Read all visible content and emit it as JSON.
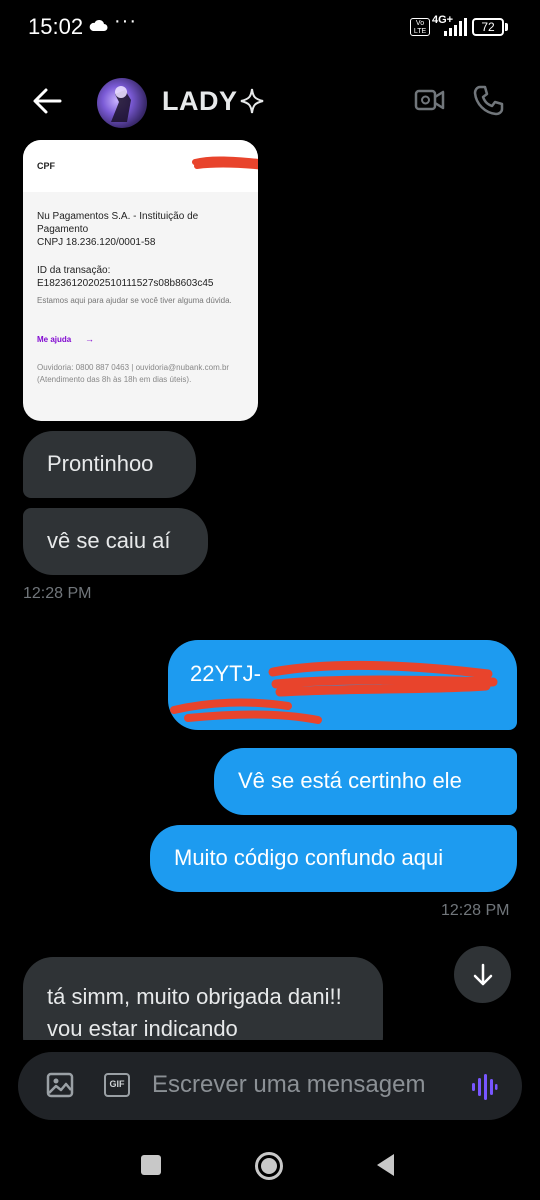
{
  "status_bar": {
    "time": "15:02",
    "dots": "···",
    "volte": "Vo LTE",
    "network": "4G+",
    "battery": "72"
  },
  "header": {
    "contact_name": "LADY"
  },
  "receipt": {
    "cpf_label": "CPF",
    "cpf_masked": "•••••••••••",
    "institution": "Nu Pagamentos S.A. - Instituição de Pagamento",
    "cnpj": "CNPJ 18.236.120/0001-58",
    "transaction_label": "ID da transação:",
    "transaction_id": "E18236120202510111527s08b8603c45",
    "help_text": "Estamos aqui para ajudar se você tiver alguma dúvida.",
    "help_link": "Me ajuda",
    "ombudsman": "Ouvidoria: 0800 887 0463 | ouvidoria@nubank.com.br (Atendimento das 8h às 18h em dias úteis)."
  },
  "messages": [
    {
      "direction": "in",
      "text": "Prontinhoo"
    },
    {
      "direction": "in",
      "text": "vê se caiu aí"
    },
    {
      "direction": "out",
      "text": "22YTJ-"
    },
    {
      "direction": "out",
      "text": "Vê se está certinho ele"
    },
    {
      "direction": "out",
      "text": "Muito código confundo aqui"
    },
    {
      "direction": "in",
      "text": "tá simm, muito obrigada dani!! vou estar indicando"
    }
  ],
  "timestamps": {
    "incoming": "12:28 PM",
    "outgoing": "12:28 PM"
  },
  "composer": {
    "gif_label": "GIF",
    "placeholder": "Escrever uma mensagem"
  },
  "colors": {
    "background": "#000000",
    "incoming_bubble": "#2f3336",
    "outgoing_bubble": "#1d9bf0",
    "redaction": "#e8442c",
    "voice_accent": "#7856ff"
  }
}
